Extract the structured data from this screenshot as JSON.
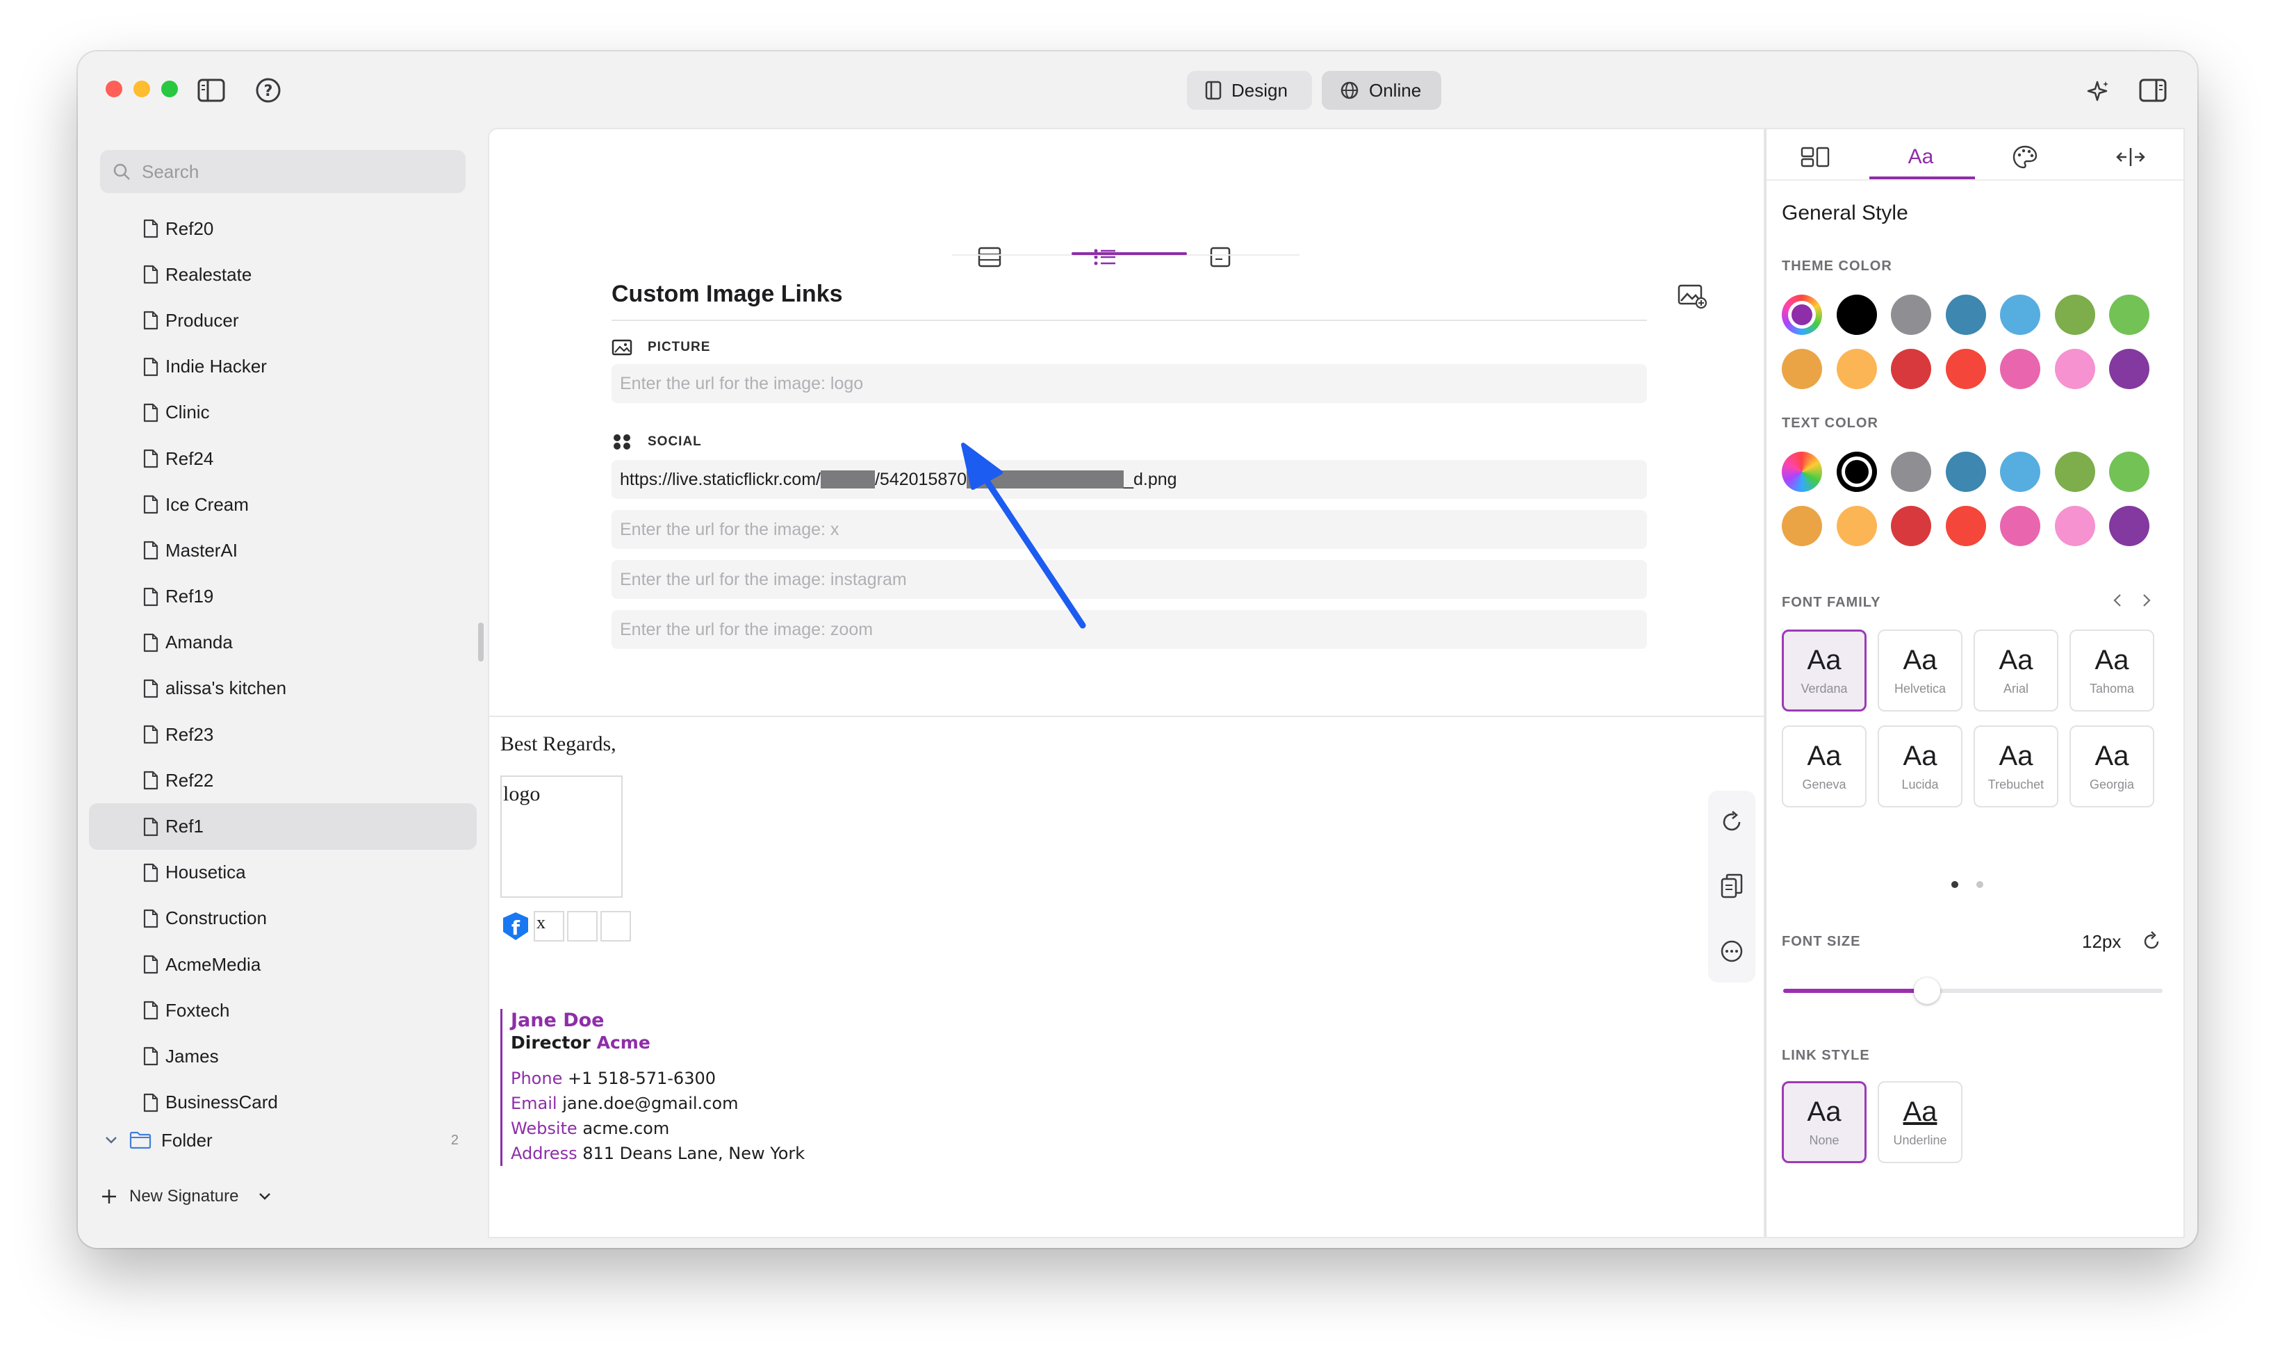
{
  "toolbar": {
    "design_label": "Design",
    "online_label": "Online"
  },
  "sidebar": {
    "search_placeholder": "Search",
    "items": [
      {
        "label": "Ref20"
      },
      {
        "label": "Realestate"
      },
      {
        "label": "Producer"
      },
      {
        "label": "Indie Hacker"
      },
      {
        "label": "Clinic"
      },
      {
        "label": "Ref24"
      },
      {
        "label": "Ice Cream"
      },
      {
        "label": "MasterAI"
      },
      {
        "label": "Ref19"
      },
      {
        "label": "Amanda"
      },
      {
        "label": "alissa's kitchen"
      },
      {
        "label": "Ref23"
      },
      {
        "label": "Ref22"
      },
      {
        "label": "Ref1"
      },
      {
        "label": "Housetica"
      },
      {
        "label": "Construction"
      },
      {
        "label": "AcmeMedia"
      },
      {
        "label": "Foxtech"
      },
      {
        "label": "James"
      },
      {
        "label": "BusinessCard"
      }
    ],
    "selected_item": "Ref1",
    "folder_label": "Folder",
    "folder_count": "2",
    "new_signature_label": "New Signature"
  },
  "editor": {
    "section_title": "Custom Image Links",
    "picture_label": "PICTURE",
    "picture_placeholder": "Enter the url for the image: logo",
    "social_label": "SOCIAL",
    "social_url_prefix": "https://live.staticflickr.com/",
    "social_url_mid": "/542015870",
    "social_url_suffix": "_d.png",
    "x_placeholder": "Enter the url for the image: x",
    "instagram_placeholder": "Enter the url for the image: instagram",
    "zoom_placeholder": "Enter the url for the image: zoom"
  },
  "preview": {
    "greeting": "Best Regards,",
    "logo_alt": "logo",
    "x_alt": "x",
    "name": "Jane Doe",
    "title": "Director",
    "company": "Acme",
    "phone_label": "Phone",
    "phone": "+1 518-571-6300",
    "email_label": "Email",
    "email": "jane.doe@gmail.com",
    "website_label": "Website",
    "website": "acme.com",
    "address_label": "Address",
    "address": "811 Deans Lane, New York"
  },
  "style_panel": {
    "tab_text_label": "Aa",
    "heading": "General Style",
    "theme_color_label": "THEME COLOR",
    "text_color_label": "TEXT COLOR",
    "palette": [
      "#000000",
      "#8e8e93",
      "#3d87b0",
      "#56ade0",
      "#7ead4c",
      "#72c256",
      "#eaa446",
      "#fcb555",
      "#d8393c",
      "#f4463a",
      "#e965ae",
      "#f592cf",
      "#83399f"
    ],
    "accent_color": "#8e2ea8",
    "font_family_label": "FONT FAMILY",
    "fonts": [
      {
        "sample": "Aa",
        "name": "Verdana"
      },
      {
        "sample": "Aa",
        "name": "Helvetica"
      },
      {
        "sample": "Aa",
        "name": "Arial"
      },
      {
        "sample": "Aa",
        "name": "Tahoma"
      },
      {
        "sample": "Aa",
        "name": "Geneva"
      },
      {
        "sample": "Aa",
        "name": "Lucida"
      },
      {
        "sample": "Aa",
        "name": "Trebuchet"
      },
      {
        "sample": "Aa",
        "name": "Georgia"
      }
    ],
    "selected_font": "Verdana",
    "font_size_label": "FONT SIZE",
    "font_size_value": "12px",
    "font_size_fraction": 0.38,
    "link_style_label": "LINK STYLE",
    "link_styles": [
      {
        "sample": "Aa",
        "name": "None"
      },
      {
        "sample": "Aa",
        "name": "Underline"
      }
    ],
    "selected_link_style": "None"
  }
}
